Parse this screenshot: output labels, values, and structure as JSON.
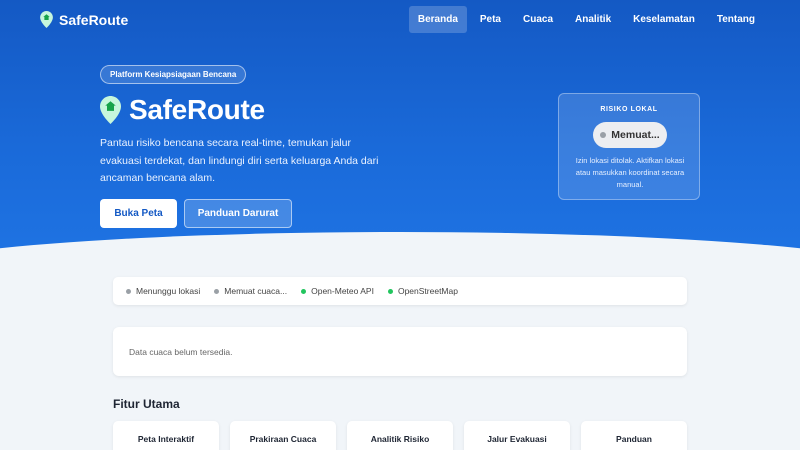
{
  "nav": {
    "brand": "SafeRoute",
    "links": [
      {
        "label": "Beranda",
        "active": true
      },
      {
        "label": "Peta",
        "active": false
      },
      {
        "label": "Cuaca",
        "active": false
      },
      {
        "label": "Analitik",
        "active": false
      },
      {
        "label": "Keselamatan",
        "active": false
      },
      {
        "label": "Tentang",
        "active": false
      }
    ]
  },
  "hero": {
    "pill": "Platform Kesiapsiagaan Bencana",
    "title": "SafeRoute",
    "description": "Pantau risiko bencana secara real-time, temukan jalur evakuasi terdekat, dan lindungi diri serta keluarga Anda dari ancaman bencana alam.",
    "primary_button": "Buka Peta",
    "secondary_button": "Panduan Darurat"
  },
  "risk_card": {
    "title": "RISIKO LOKAL",
    "badge": "Memuat...",
    "note": "Izin lokasi ditolak. Aktifkan lokasi atau masukkan koordinat secara manual."
  },
  "status": [
    {
      "label": "Menunggu lokasi",
      "color": "#9aa0a6"
    },
    {
      "label": "Memuat cuaca...",
      "color": "#9aa0a6"
    },
    {
      "label": "Open-Meteo API",
      "color": "#22c55e"
    },
    {
      "label": "OpenStreetMap",
      "color": "#22c55e"
    }
  ],
  "weather": {
    "message": "Data cuaca belum tersedia."
  },
  "features": {
    "title": "Fitur Utama",
    "items": [
      {
        "label": "Peta Interaktif"
      },
      {
        "label": "Prakiraan Cuaca"
      },
      {
        "label": "Analitik Risiko"
      },
      {
        "label": "Jalur Evakuasi"
      },
      {
        "label": "Panduan"
      }
    ]
  },
  "colors": {
    "primary": "#1459c4",
    "online": "#22c55e",
    "pending": "#9aa0a6"
  }
}
